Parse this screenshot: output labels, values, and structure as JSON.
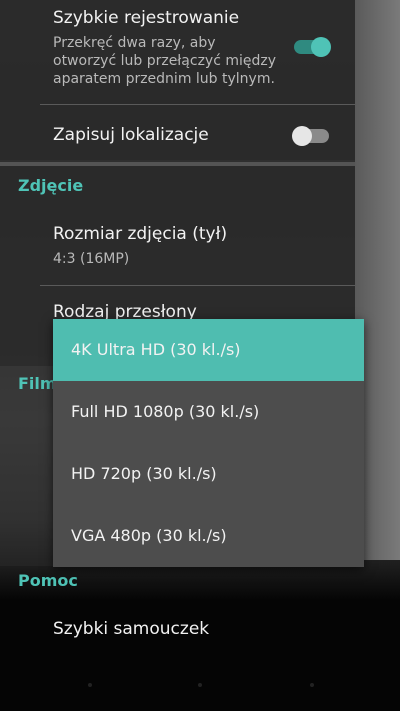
{
  "settings": {
    "quick_launch": {
      "title": "Szybkie rejestrowanie",
      "desc": "Przekręć dwa razy, aby otworzyć lub przełączyć między aparatem przednim lub tylnym.",
      "enabled": true
    },
    "save_location": {
      "title": "Zapisuj lokalizacje",
      "enabled": false
    },
    "photo_section": "Zdjęcie",
    "photo_size": {
      "title": "Rozmiar zdjęcia (tył)",
      "value": "4:3 (16MP)"
    },
    "shutter_type": {
      "title": "Rodzaj przesłony"
    },
    "film_section": "Film",
    "help_section": "Pomoc",
    "quick_tutorial": "Szybki samouczek"
  },
  "dropdown": {
    "options": [
      "4K Ultra HD (30 kl./s)",
      "Full HD 1080p (30 kl./s)",
      "HD 720p (30 kl./s)",
      "VGA 480p (30 kl./s)"
    ],
    "selected_index": 0
  },
  "colors": {
    "accent": "#4fc3b6",
    "selected_option": "#4fbdb0",
    "panel": "#2a2a2a",
    "dropdown": "#4d4d4d"
  }
}
